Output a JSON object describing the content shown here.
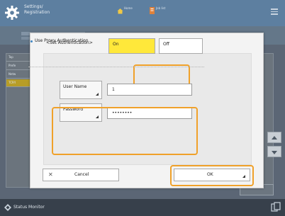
{
  "app": {
    "title": "Settings/",
    "subtitle": "Registration",
    "toolbar_buttons": [
      {
        "label": "Home",
        "icon": "home-icon"
      },
      {
        "label": "Job list",
        "icon": "job-list-icon"
      }
    ],
    "menu_icon": "hamburger-menu-icon"
  },
  "background_list": {
    "rows": [
      "Top",
      "Prefe",
      "Netw",
      "TCP/I"
    ],
    "selected_index": 3
  },
  "dialog": {
    "title": "<Set Authentication>",
    "use_proxy_auth": {
      "label": "Use Proxy Authentication",
      "on_label": "On",
      "off_label": "Off",
      "selected": "On"
    },
    "user_name": {
      "label": "User Name",
      "value": "1"
    },
    "password": {
      "label": "Password",
      "value": "••••••••"
    },
    "cancel_label": "Cancel",
    "ok_label": "OK"
  },
  "status_bar": {
    "label": "Status Monitor"
  },
  "colors": {
    "topbar": "#5d7fa0",
    "selected_toggle": "#ffe83a",
    "highlight_ring": "#f0a12a",
    "status_bar": "#37404b"
  }
}
